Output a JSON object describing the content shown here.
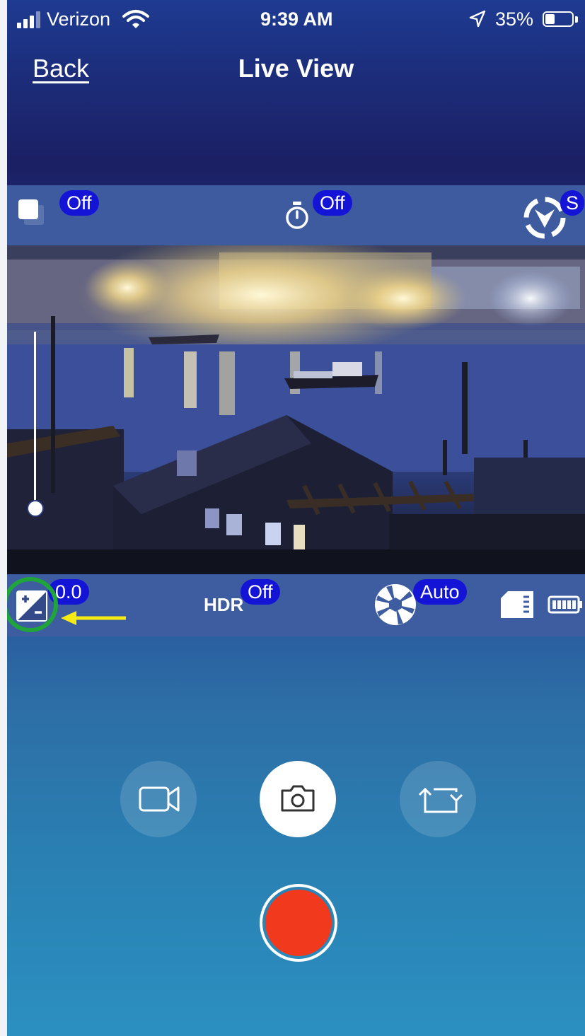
{
  "status_bar": {
    "carrier": "Verizon",
    "time": "9:39 AM",
    "battery_percent": "35%",
    "signal_icon": "signal-bars-icon",
    "wifi_icon": "wifi-icon",
    "location_icon": "location-arrow-icon",
    "battery_icon": "battery-icon",
    "battery_level": 0.35
  },
  "nav": {
    "back_label": "Back",
    "title": "Live View"
  },
  "top_settings": {
    "drive_mode_value": "Off",
    "timer_value": "Off",
    "mode_value": "S",
    "icons": [
      "drive-mode-icon",
      "self-timer-icon",
      "shooting-mode-icon"
    ]
  },
  "viewfinder": {
    "slider_level": 0.0,
    "scene": "night harbor live preview"
  },
  "bottom_settings": {
    "exposure_value": "0.0",
    "hdr_label": "HDR",
    "hdr_value": "Off",
    "aperture_value": "Auto",
    "icons": [
      "exposure-compensation-icon",
      "aperture-icon",
      "sd-card-icon",
      "camera-battery-icon"
    ]
  },
  "controls": {
    "icons": [
      "video-mode-icon",
      "photo-mode-icon",
      "switch-camera-icon",
      "shutter-icon"
    ]
  },
  "colors": {
    "accent_pill": "#1414d6",
    "shutter_red": "#f0391d",
    "highlight_circle": "#1fa53a",
    "arrow_yellow": "#f5ea12"
  }
}
